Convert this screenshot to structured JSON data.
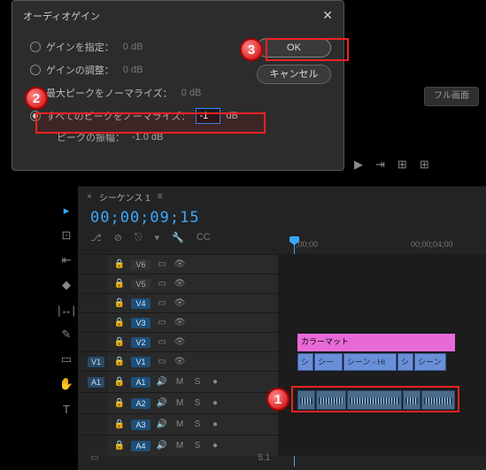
{
  "dialog": {
    "title": "オーディオゲイン",
    "options": {
      "set_gain": {
        "label": "ゲインを指定：",
        "value": "0 dB"
      },
      "adjust_gain": {
        "label": "ゲインの調整：",
        "value": "0 dB"
      },
      "norm_max": {
        "label": "最大ピークをノーマライズ：",
        "value": "0 dB"
      },
      "norm_all": {
        "label": "すべてのピークをノーマライズ：",
        "input": "-1",
        "unit": "dB"
      }
    },
    "amplitude": {
      "label": "ピークの振幅：",
      "value": "-1.0 dB"
    },
    "ok": "OK",
    "cancel": "キャンセル"
  },
  "callouts": {
    "c1": "1",
    "c2": "2",
    "c3": "3"
  },
  "topbar": {
    "fullscreen": "フル画面"
  },
  "monitor_icons": {
    "play": "▶",
    "step": "⇥",
    "add1": "⊞",
    "add2": "⊞"
  },
  "sequence": {
    "close": "×",
    "name": "シーケンス 1",
    "menu": "≡"
  },
  "timecode": "00;00;09;15",
  "tl_icons": {
    "snap": "⎇",
    "link": "⊘",
    "magnet": "⎋",
    "marker1": "▾",
    "wrench": "🔧",
    "cc": "CC"
  },
  "ruler": {
    "t0": ";00;00",
    "t1": "00;00;04;00"
  },
  "tracks": {
    "v6": "V6",
    "v5": "V5",
    "v4": "V4",
    "v3": "V3",
    "v2": "V2",
    "v1": "V1",
    "a1": "A1",
    "a2": "A2",
    "a3": "A3",
    "a4": "A4",
    "src_v1": "V1",
    "src_a1": "A1",
    "icons": {
      "lock": "🔒",
      "toggle": "▭",
      "eye": "👁",
      "spk": "🔊",
      "mute": "M",
      "solo": "S",
      "rec": "●"
    }
  },
  "clips": {
    "colormat": "カラーマット",
    "v": {
      "c1": "シ",
      "c2": "シー",
      "c3": "シーン - Hi",
      "c4": "シ",
      "c5": "シーン"
    }
  },
  "mixer": {
    "master": "▭",
    "out": "5.1"
  },
  "tools": {
    "select": "▸",
    "marquee": "⊡",
    "ripple": "⇤",
    "razor": "◆",
    "slip": "|↔|",
    "pen": "✎",
    "rect": "▭",
    "hand": "✋",
    "type": "T"
  }
}
